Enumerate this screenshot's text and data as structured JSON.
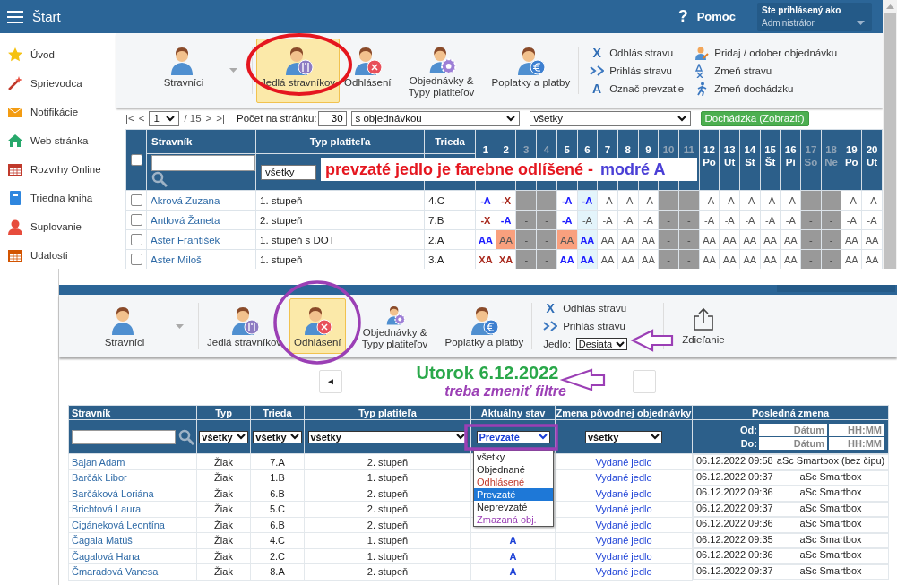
{
  "top": {
    "header": {
      "title": "Štart",
      "help_icon": "?",
      "help": "Pomoc",
      "user_label": "Ste prihlásený ako",
      "user_name": "Administrátor"
    },
    "sidebar": [
      {
        "label": "Úvod"
      },
      {
        "label": "Sprievodca"
      },
      {
        "label": "Notifikácie"
      },
      {
        "label": "Web stránka"
      },
      {
        "label": "Rozvrhy Online"
      },
      {
        "label": "Triedna kniha"
      },
      {
        "label": "Suplovanie"
      },
      {
        "label": "Udalosti"
      }
    ],
    "ribbon": {
      "modules": [
        {
          "label": "Stravníci",
          "selected": false,
          "has_menu": true
        },
        {
          "label": "Jedlá stravníkov",
          "selected": true,
          "has_menu": false
        },
        {
          "label": "Odhlásení",
          "selected": false,
          "has_menu": false
        },
        {
          "label": "Objednávky & Typy platiteľov",
          "selected": false,
          "has_menu": false
        },
        {
          "label": "Poplatky a platby",
          "selected": false,
          "has_menu": false
        }
      ],
      "actions": [
        {
          "icon_text": "X",
          "label": "Odhlás stravu"
        },
        {
          "label": "Prihlás stravu"
        },
        {
          "icon_text": "A",
          "label": "Označ prevzatie"
        },
        {
          "label": "Pridaj / odober objednávku"
        },
        {
          "label": "Zmeň stravu"
        },
        {
          "label": "Zmeň dochádzku"
        }
      ]
    },
    "pagination": {
      "first": "|<",
      "prev": "<",
      "page": "1",
      "total": "/ 15",
      "next": ">",
      "last": ">|",
      "per_page_label": "Počet na stránku:",
      "per_page": "30",
      "filter_1": "s objednávkou",
      "filter_2": "všetky",
      "attendance_button": "Dochádzka (Zobraziť)"
    },
    "table": {
      "select_all_checked": false,
      "columns": [
        "Stravník",
        "Typ platiteľa",
        "Trieda"
      ],
      "payer_filter": "všetky",
      "days": [
        {
          "day": "1",
          "weekend": false,
          "today": false
        },
        {
          "day": "2",
          "weekend": false,
          "today": false
        },
        {
          "day": "3",
          "weekend": true,
          "today": false
        },
        {
          "day": "4",
          "weekend": true,
          "today": false
        },
        {
          "day": "5",
          "weekend": false,
          "today": false
        },
        {
          "day": "6",
          "weekend": false,
          "today": true
        },
        {
          "day": "7",
          "weekend": false,
          "today": false
        },
        {
          "day": "8",
          "weekend": false,
          "today": false
        },
        {
          "day": "9",
          "weekend": false,
          "today": false
        },
        {
          "day": "10",
          "weekend": true,
          "today": false
        },
        {
          "day": "11",
          "weekend": true,
          "today": false
        },
        {
          "day": "12",
          "weekday": "Po",
          "weekend": false,
          "today": false
        },
        {
          "day": "13",
          "weekday": "Ut",
          "weekend": false,
          "today": false
        },
        {
          "day": "14",
          "weekday": "St",
          "weekend": false,
          "today": false
        },
        {
          "day": "15",
          "weekday": "Št",
          "weekend": false,
          "today": false
        },
        {
          "day": "16",
          "weekday": "Pi",
          "weekend": false,
          "today": false
        },
        {
          "day": "17",
          "weekday": "So",
          "weekend": true,
          "today": false
        },
        {
          "day": "18",
          "weekday": "Ne",
          "weekend": true,
          "today": false
        },
        {
          "day": "19",
          "weekday": "Po",
          "weekend": false,
          "today": false
        },
        {
          "day": "20",
          "weekday": "Ut",
          "weekend": false,
          "today": false
        }
      ],
      "rows": [
        {
          "name": "Akrová Zuzana",
          "payer": "1. stupeň",
          "class": "4.C",
          "checked": false,
          "cells": [
            {
              "text": "-A",
              "kind": "taken"
            },
            {
              "text": "-X",
              "kind": "cancelled"
            },
            {
              "text": "-",
              "kind": "weekend"
            },
            {
              "text": "-",
              "kind": "weekend"
            },
            {
              "text": "-A",
              "kind": "taken"
            },
            {
              "text": "-A",
              "kind": "taken"
            },
            {
              "text": "-A",
              "kind": "plain"
            },
            {
              "text": "-A",
              "kind": "plain"
            },
            {
              "text": "-A",
              "kind": "plain"
            },
            {
              "text": "-",
              "kind": "weekend"
            },
            {
              "text": "-",
              "kind": "weekend"
            },
            {
              "text": "-A",
              "kind": "plain"
            },
            {
              "text": "-A",
              "kind": "plain"
            },
            {
              "text": "-A",
              "kind": "plain"
            },
            {
              "text": "-A",
              "kind": "plain"
            },
            {
              "text": "-A",
              "kind": "plain"
            },
            {
              "text": "-",
              "kind": "weekend"
            },
            {
              "text": "-",
              "kind": "weekend"
            },
            {
              "text": "-A",
              "kind": "plain"
            },
            {
              "text": "-A",
              "kind": "plain"
            }
          ]
        },
        {
          "name": "Antlová Žaneta",
          "payer": "2. stupeň",
          "class": "7.B",
          "checked": false,
          "cells": [
            {
              "text": "-X",
              "kind": "cancelled"
            },
            {
              "text": "-A",
              "kind": "taken"
            },
            {
              "text": "-",
              "kind": "weekend"
            },
            {
              "text": "-",
              "kind": "weekend"
            },
            {
              "text": "-A",
              "kind": "taken"
            },
            {
              "text": "-A",
              "kind": "plain"
            },
            {
              "text": "-A",
              "kind": "plain"
            },
            {
              "text": "-A",
              "kind": "plain"
            },
            {
              "text": "-A",
              "kind": "plain"
            },
            {
              "text": "-",
              "kind": "weekend"
            },
            {
              "text": "-",
              "kind": "weekend"
            },
            {
              "text": "-A",
              "kind": "plain"
            },
            {
              "text": "-A",
              "kind": "plain"
            },
            {
              "text": "-A",
              "kind": "plain"
            },
            {
              "text": "-A",
              "kind": "plain"
            },
            {
              "text": "-A",
              "kind": "plain"
            },
            {
              "text": "-",
              "kind": "weekend"
            },
            {
              "text": "-",
              "kind": "weekend"
            },
            {
              "text": "-A",
              "kind": "plain"
            },
            {
              "text": "-A",
              "kind": "plain"
            }
          ]
        },
        {
          "name": "Aster František",
          "payer": "1. stupeň s DOT",
          "class": "2.A",
          "checked": false,
          "cells": [
            {
              "text": "AA",
              "kind": "taken"
            },
            {
              "text": "AA",
              "kind": "changed"
            },
            {
              "text": "-",
              "kind": "weekend"
            },
            {
              "text": "-",
              "kind": "weekend"
            },
            {
              "text": "AA",
              "kind": "changed"
            },
            {
              "text": "AA",
              "kind": "taken"
            },
            {
              "text": "AA",
              "kind": "plain"
            },
            {
              "text": "AA",
              "kind": "plain"
            },
            {
              "text": "AA",
              "kind": "plain"
            },
            {
              "text": "-",
              "kind": "weekend"
            },
            {
              "text": "-",
              "kind": "weekend"
            },
            {
              "text": "AA",
              "kind": "plain"
            },
            {
              "text": "AA",
              "kind": "plain"
            },
            {
              "text": "AA",
              "kind": "plain"
            },
            {
              "text": "AA",
              "kind": "plain"
            },
            {
              "text": "AA",
              "kind": "plain"
            },
            {
              "text": "-",
              "kind": "weekend"
            },
            {
              "text": "-",
              "kind": "weekend"
            },
            {
              "text": "AA",
              "kind": "plain"
            },
            {
              "text": "AA",
              "kind": "plain"
            }
          ]
        },
        {
          "name": "Aster Miloš",
          "payer": "1. stupeň",
          "class": "3.A",
          "checked": false,
          "cells": [
            {
              "text": "XA",
              "kind": "cancelled"
            },
            {
              "text": "XA",
              "kind": "cancelled"
            },
            {
              "text": "-",
              "kind": "weekend"
            },
            {
              "text": "-",
              "kind": "weekend"
            },
            {
              "text": "AA",
              "kind": "taken"
            },
            {
              "text": "AA",
              "kind": "taken"
            },
            {
              "text": "AA",
              "kind": "plain"
            },
            {
              "text": "AA",
              "kind": "plain"
            },
            {
              "text": "AA",
              "kind": "plain"
            },
            {
              "text": "-",
              "kind": "weekend"
            },
            {
              "text": "-",
              "kind": "weekend"
            },
            {
              "text": "AA",
              "kind": "plain"
            },
            {
              "text": "AA",
              "kind": "plain"
            },
            {
              "text": "AA",
              "kind": "plain"
            },
            {
              "text": "AA",
              "kind": "plain"
            },
            {
              "text": "AA",
              "kind": "plain"
            },
            {
              "text": "-",
              "kind": "weekend"
            },
            {
              "text": "-",
              "kind": "weekend"
            },
            {
              "text": "AA",
              "kind": "plain"
            },
            {
              "text": "AA",
              "kind": "plain"
            }
          ]
        }
      ]
    },
    "annotation": {
      "text": "prevzaté jedlo je farebne odlíšené -",
      "highlight": "modré A"
    }
  },
  "bottom": {
    "ribbon": {
      "modules": [
        {
          "label": "Stravníci",
          "selected": false,
          "has_menu": true
        },
        {
          "label": "Jedlá stravníkov",
          "selected": false,
          "has_menu": false
        },
        {
          "label": "Odhlásení",
          "selected": true,
          "has_menu": false
        },
        {
          "label": "Objednávky & Typy platiteľov",
          "selected": false,
          "has_menu": false
        },
        {
          "label": "Poplatky a platby",
          "selected": false,
          "has_menu": false
        }
      ],
      "actions": [
        {
          "icon_text": "X",
          "label": "Odhlás stravu"
        },
        {
          "label": "Prihlás stravu"
        }
      ],
      "meal_label": "Jedlo:",
      "meal": "Desiata",
      "share": "Zdieľanie"
    },
    "date_nav": {
      "prev": "◄",
      "date": "Utorok 6.12.2022",
      "note": "treba zmeniť filtre"
    },
    "table": {
      "columns": [
        "Stravník",
        "Typ",
        "Trieda",
        "Typ platiteľa",
        "Aktuálny stav",
        "Zmena pôvodnej objednávky",
        "Posledná zmena"
      ],
      "filters": {
        "type": "všetky",
        "class": "všetky",
        "payer": "všetky",
        "status": "Prevzaté",
        "change": "všetky",
        "from_label": "Od:",
        "from_date_placeholder": "Dátum",
        "from_time_placeholder": "HH:MM",
        "to_label": "Do:",
        "to_date_placeholder": "Dátum",
        "to_time_placeholder": "HH:MM"
      },
      "rows": [
        {
          "name": "Bajan Adam",
          "type": "Žiak",
          "class": "7.A",
          "payer": "2. stupeň",
          "change": "Vydané jedlo",
          "time": "06.12.2022 09:58",
          "source": "aSc Smartbox (bez čipu)"
        },
        {
          "name": "Barčák Libor",
          "type": "Žiak",
          "class": "1.B",
          "payer": "1. stupeň",
          "change": "Vydané jedlo",
          "time": "06.12.2022 09:37",
          "source": "aSc Smartbox"
        },
        {
          "name": "Barčáková Loriána",
          "type": "Žiak",
          "class": "6.B",
          "payer": "2. stupeň",
          "change": "Vydané jedlo",
          "time": "06.12.2022 09:36",
          "source": "aSc Smartbox"
        },
        {
          "name": "Brichtová Laura",
          "type": "Žiak",
          "class": "5.C",
          "payer": "2. stupeň",
          "change": "Vydané jedlo",
          "time": "06.12.2022 09:37",
          "source": "aSc Smartbox"
        },
        {
          "name": "Cigáneková Leontína",
          "type": "Žiak",
          "class": "6.B",
          "payer": "2. stupeň",
          "change": "Vydané jedlo",
          "time": "06.12.2022 09:36",
          "source": "aSc Smartbox"
        },
        {
          "name": "Čagala Matúš",
          "type": "Žiak",
          "class": "4.C",
          "payer": "1. stupeň",
          "status": "A",
          "change": "Vydané jedlo",
          "time": "06.12.2022 09:35",
          "source": "aSc Smartbox"
        },
        {
          "name": "Čagalová Hana",
          "type": "Žiak",
          "class": "2.C",
          "payer": "1. stupeň",
          "status": "A",
          "change": "Vydané jedlo",
          "time": "06.12.2022 09:36",
          "source": "aSc Smartbox"
        },
        {
          "name": "Čmaradová Vanesa",
          "type": "Žiak",
          "class": "8.A",
          "payer": "2. stupeň",
          "status": "A",
          "change": "Vydané jedlo",
          "time": "06.12.2022 09:37",
          "source": "aSc Smartbox"
        }
      ]
    },
    "status_options": [
      {
        "label": "všetky",
        "color": "#222222",
        "selected": false
      },
      {
        "label": "Objednané",
        "color": "#222222",
        "selected": false
      },
      {
        "label": "Odhlásené",
        "color": "#c0392b",
        "selected": false
      },
      {
        "label": "Prevzaté",
        "color": "#1e78d7",
        "selected": true
      },
      {
        "label": "Neprevzaté",
        "color": "#222222",
        "selected": false
      },
      {
        "label": "Zmazaná obj.",
        "color": "#9b3fb5",
        "selected": false
      }
    ]
  }
}
